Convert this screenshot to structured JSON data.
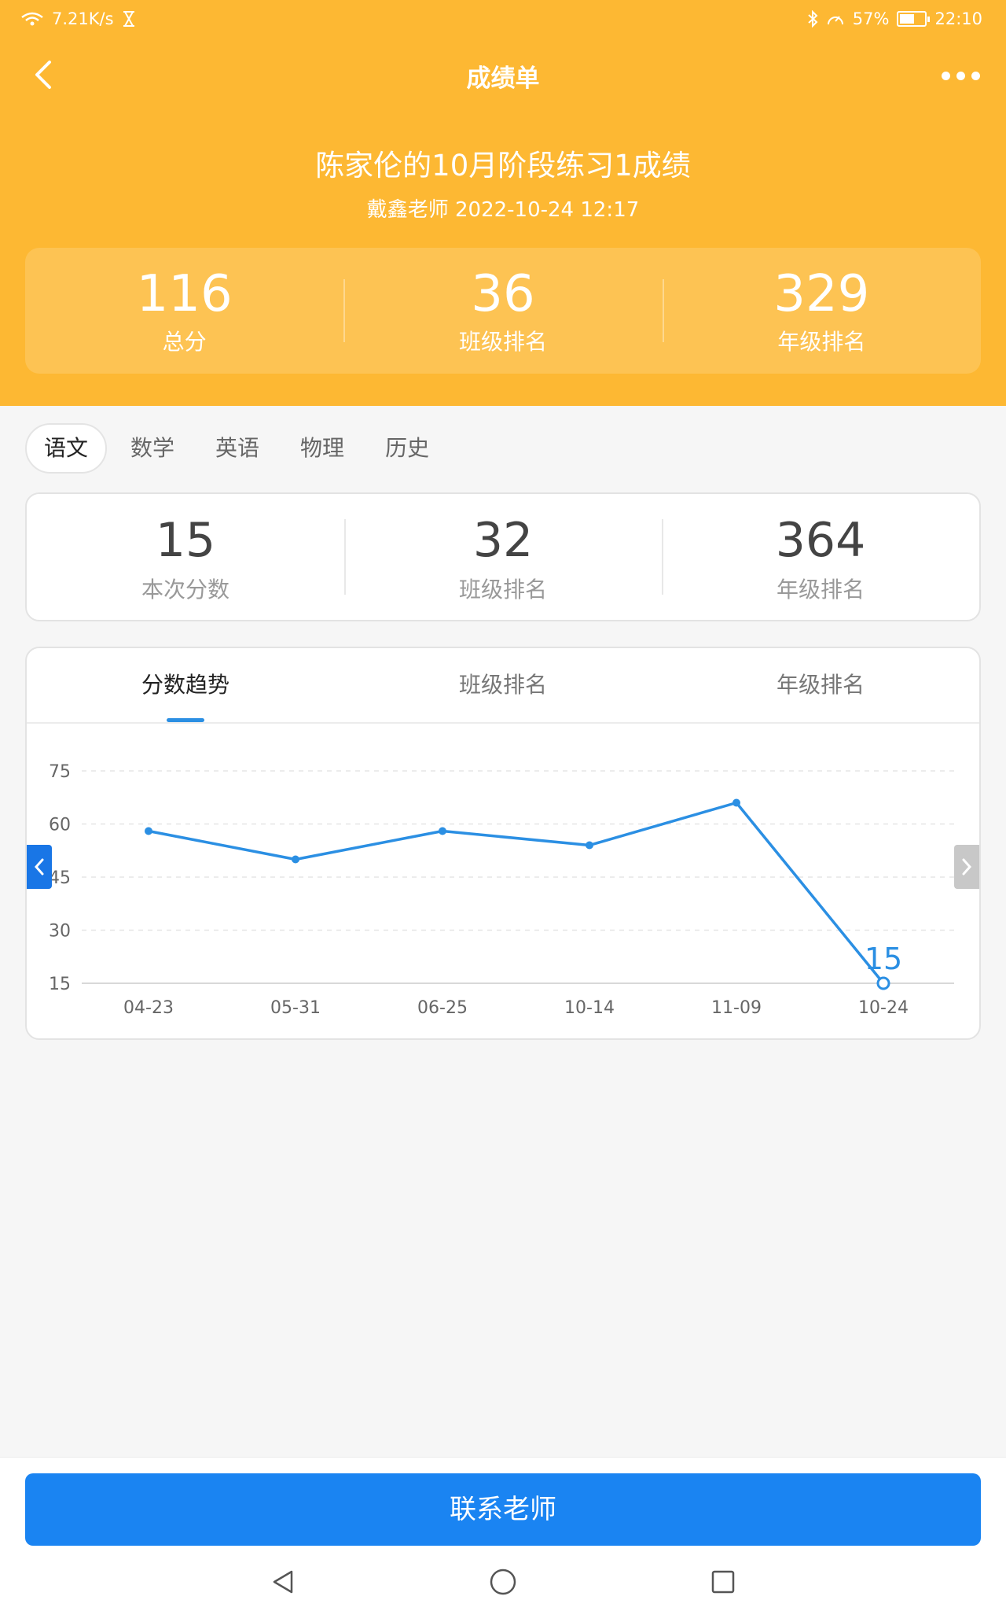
{
  "status_bar": {
    "network_speed": "7.21K/s",
    "battery": "57%",
    "time": "22:10"
  },
  "navbar": {
    "title": "成绩单"
  },
  "report": {
    "title": "陈家伦的10月阶段练习1成绩",
    "subtitle": "戴鑫老师 2022-10-24 12:17"
  },
  "summary": [
    {
      "value": "116",
      "label": "总分"
    },
    {
      "value": "36",
      "label": "班级排名"
    },
    {
      "value": "329",
      "label": "年级排名"
    }
  ],
  "subjects": [
    "语文",
    "数学",
    "英语",
    "物理",
    "历史"
  ],
  "active_subject": 0,
  "subject_score": [
    {
      "value": "15",
      "label": "本次分数"
    },
    {
      "value": "32",
      "label": "班级排名"
    },
    {
      "value": "364",
      "label": "年级排名"
    }
  ],
  "chart_tabs": [
    "分数趋势",
    "班级排名",
    "年级排名"
  ],
  "active_chart_tab": 0,
  "chart_data": {
    "type": "line",
    "x": [
      "04-23",
      "05-31",
      "06-25",
      "10-14",
      "11-09",
      "10-24"
    ],
    "series": [
      {
        "values": [
          58,
          50,
          58,
          54,
          66,
          15
        ]
      }
    ],
    "yticks": [
      15,
      30,
      45,
      60,
      75
    ],
    "ylim": [
      15,
      75
    ],
    "grid": true,
    "highlight_label": "15",
    "line_color": "#2b8fe3"
  },
  "bottom": {
    "contact_button": "联系老师"
  },
  "colors": {
    "header": "#fdb833",
    "primary": "#1a84f2"
  }
}
